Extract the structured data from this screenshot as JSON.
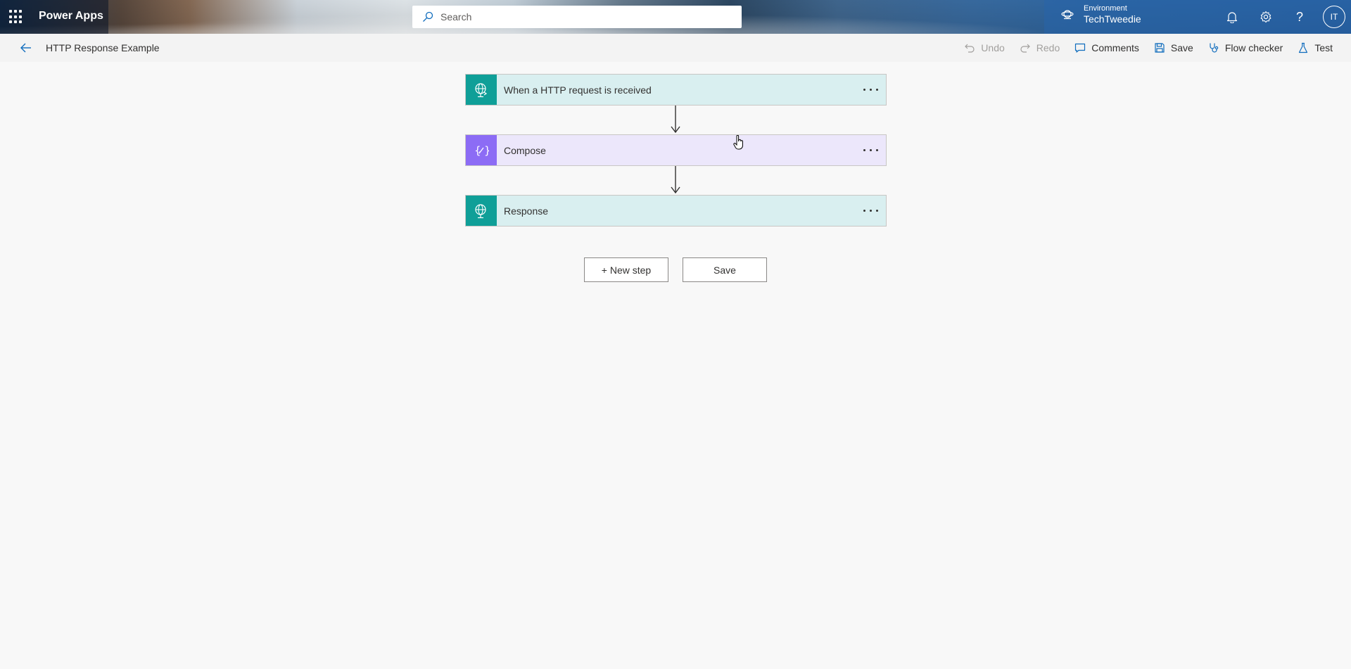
{
  "header": {
    "app_title": "Power Apps",
    "search_placeholder": "Search",
    "environment_label": "Environment",
    "environment_name": "TechTweedie",
    "avatar_initials": "IT",
    "icons": [
      "waffle-icon",
      "search-icon",
      "environment-icon",
      "bell-icon",
      "gear-icon",
      "help-icon"
    ]
  },
  "commandbar": {
    "flow_name": "HTTP Response Example",
    "undo_label": "Undo",
    "redo_label": "Redo",
    "comments_label": "Comments",
    "save_label": "Save",
    "flow_checker_label": "Flow checker",
    "test_label": "Test"
  },
  "flow": {
    "steps": [
      {
        "title": "When a HTTP request is received",
        "kind": "http-trigger",
        "color": "#0f9f98",
        "icon": "globe-icon"
      },
      {
        "title": "Compose",
        "kind": "data-operation",
        "color": "#8c6cf5",
        "icon": "compose-icon"
      },
      {
        "title": "Response",
        "kind": "http-response",
        "color": "#0f9f98",
        "icon": "globe-icon"
      }
    ],
    "new_step_label": "+ New step",
    "save_label": "Save"
  },
  "colors": {
    "http_accent": "#0f9f98",
    "compose_accent": "#8c6cf5",
    "http_card_bg": "#d9eff0",
    "compose_card_bg": "#ece7fb",
    "canvas_bg": "#f8f8f8"
  }
}
